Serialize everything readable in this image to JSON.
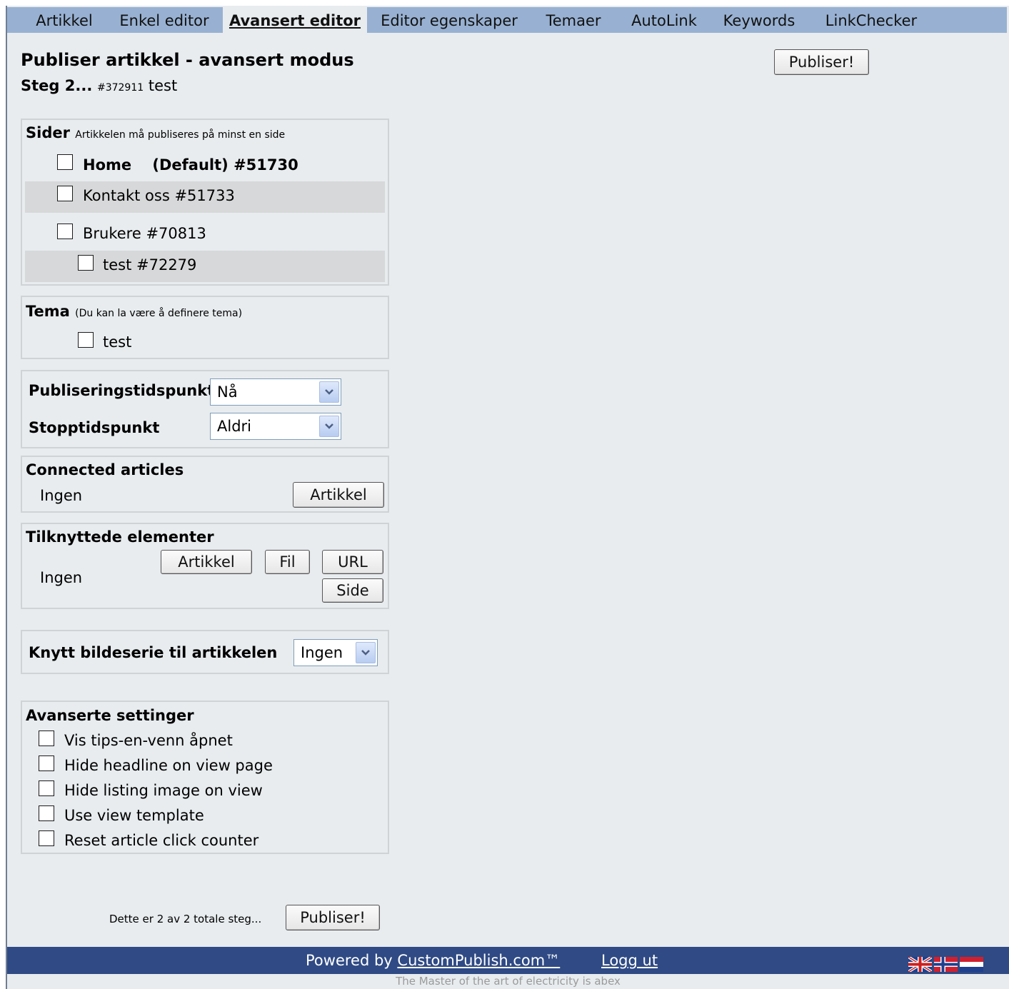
{
  "nav": {
    "tabs": [
      {
        "label": "Artikkel"
      },
      {
        "label": "Enkel editor"
      },
      {
        "label": "Avansert editor"
      },
      {
        "label": "Editor egenskaper"
      },
      {
        "label": "Temaer"
      },
      {
        "label": "AutoLink"
      },
      {
        "label": "Keywords"
      },
      {
        "label": "LinkChecker"
      }
    ]
  },
  "header": {
    "title": "Publiser artikkel - avansert modus",
    "step": "Steg 2...",
    "article_id": "#372911",
    "article_name": "test",
    "publish_button": "Publiser!"
  },
  "pages": {
    "title": "Sider",
    "note": "Artikkelen må publiseres på minst en side",
    "items": [
      {
        "name": "Home",
        "default": "(Default) #51730"
      },
      {
        "label": "Kontakt oss #51733"
      },
      {
        "label": "Brukere #70813"
      },
      {
        "label": "test #72279"
      }
    ]
  },
  "theme": {
    "title": "Tema",
    "note": "(Du kan la være å definere tema)",
    "items": [
      {
        "label": "test"
      }
    ]
  },
  "timing": {
    "publish_label": "Publiseringstidspunkt",
    "publish_value": "Nå",
    "stop_label": "Stopptidspunkt",
    "stop_value": "Aldri"
  },
  "connected": {
    "title": "Connected articles",
    "value": "Ingen",
    "button": "Artikkel"
  },
  "elements": {
    "title": "Tilknyttede elementer",
    "value": "Ingen",
    "buttons": {
      "article": "Artikkel",
      "file": "Fil",
      "url": "URL",
      "page": "Side"
    }
  },
  "gallery": {
    "label": "Knytt bildeserie til artikkelen",
    "value": "Ingen"
  },
  "advanced": {
    "title": "Avanserte settinger",
    "items": [
      {
        "label": "Vis tips-en-venn åpnet"
      },
      {
        "label": "Hide headline on view page"
      },
      {
        "label": "Hide listing image on view"
      },
      {
        "label": "Use view template"
      },
      {
        "label": "Reset article click counter"
      }
    ]
  },
  "bottom": {
    "step_text": "Dette er 2 av 2 totale steg...",
    "publish_button": "Publiser!"
  },
  "footer": {
    "powered_by": "Powered by",
    "site_link": "CustomPublish.com™",
    "logout": "Logg ut",
    "tagline": "The Master of the art of electricity is abex"
  },
  "colors": {
    "nav_bg": "#98b1d2",
    "page_bg": "#e8ecef",
    "footer_bg": "#2f4a84"
  }
}
